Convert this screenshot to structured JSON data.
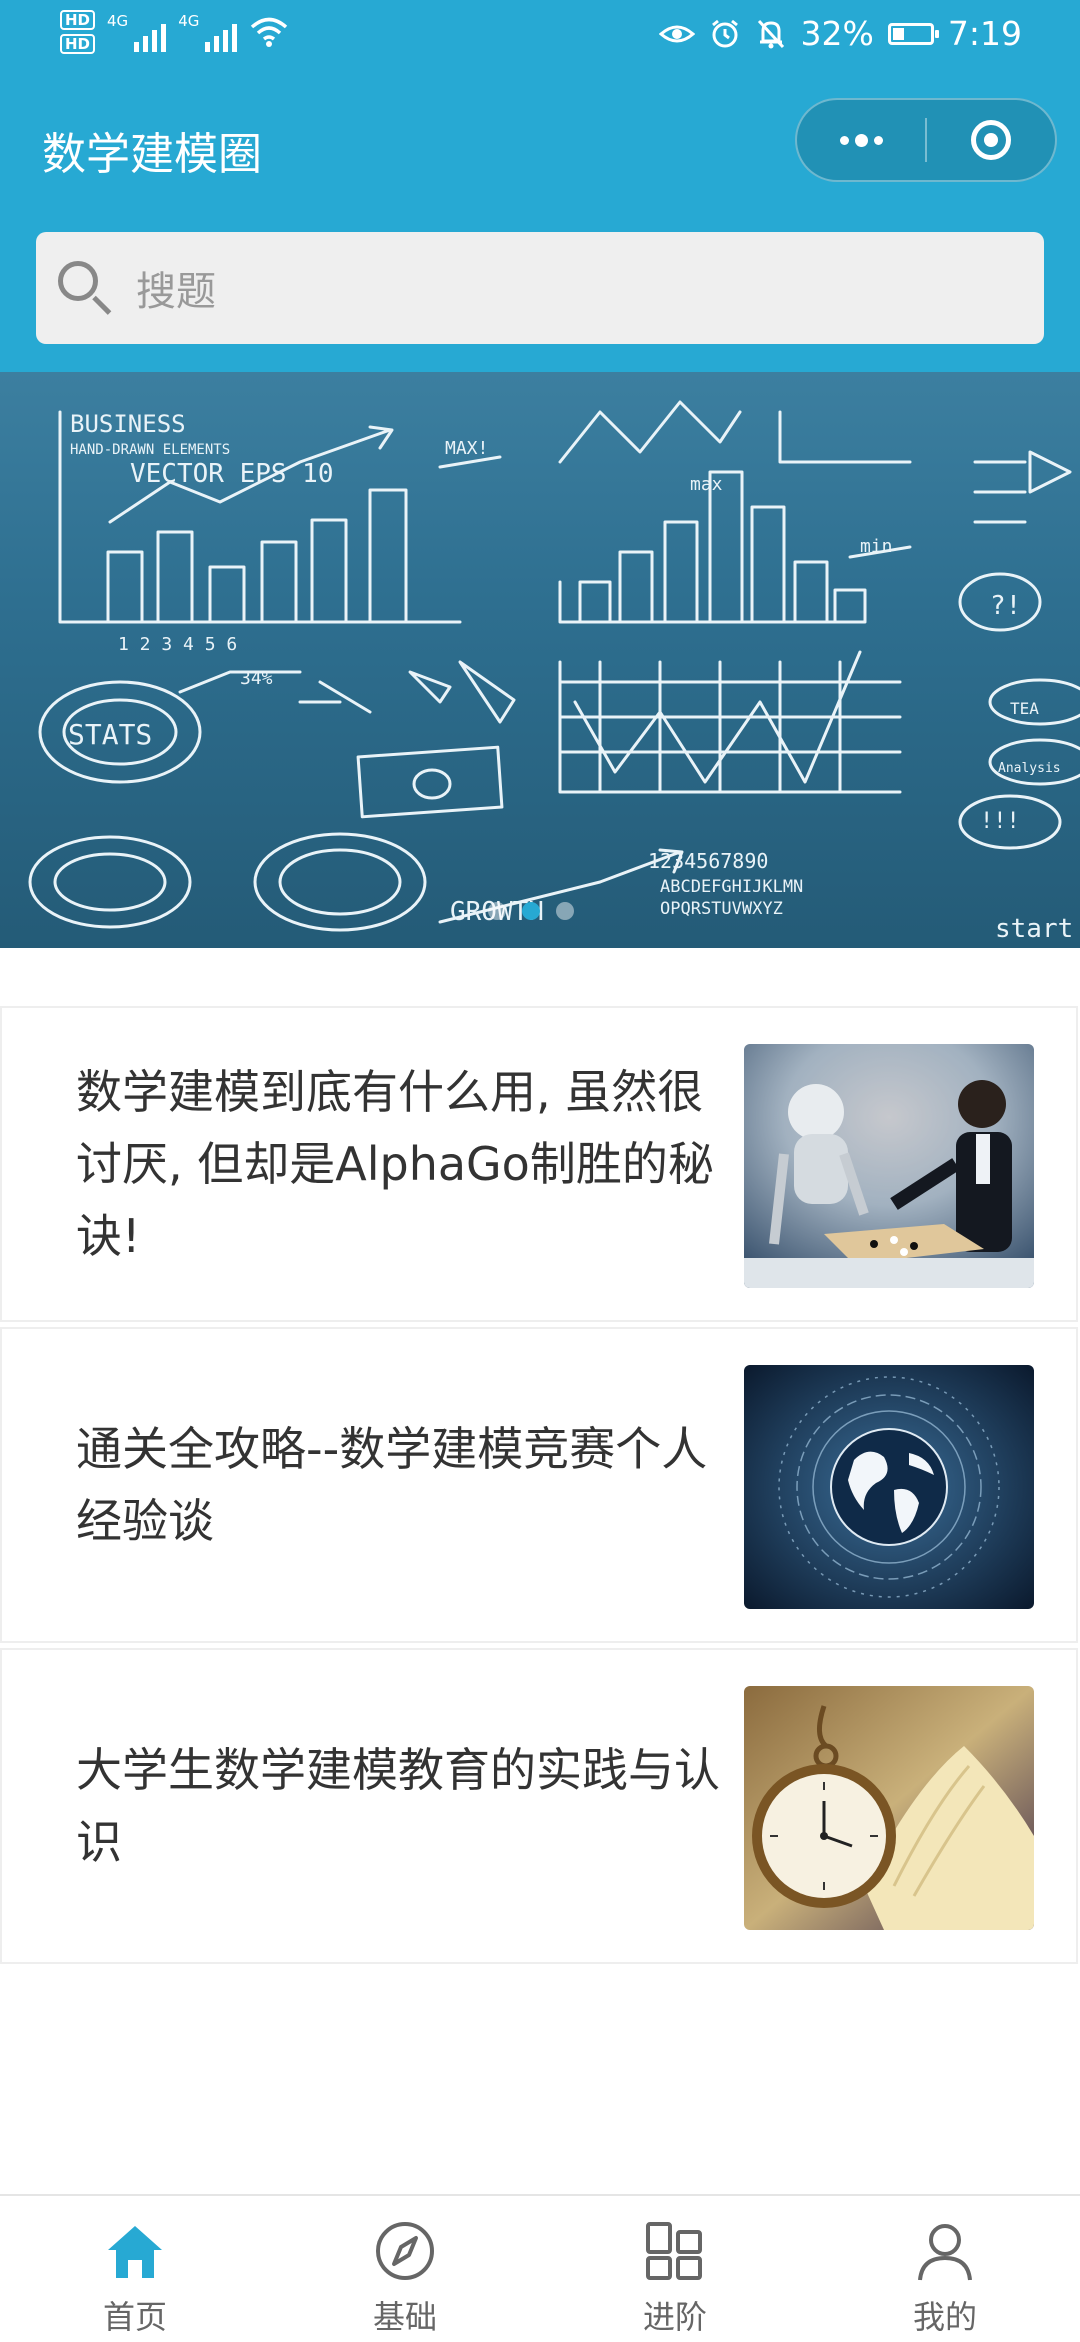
{
  "status_bar": {
    "hd_badges": [
      "HD",
      "HD"
    ],
    "network": [
      "4G",
      "4G"
    ],
    "battery_level": 32,
    "battery_percent": "32%",
    "time": "7:19"
  },
  "header": {
    "title": "数学建模圈",
    "search_placeholder": "搜题"
  },
  "banner": {
    "slide_count": 3,
    "active_slide": 1
  },
  "articles": [
    {
      "title": "数学建模到底有什么用, 虽然很讨厌, 但却是AlphaGo制胜的秘诀!",
      "image": "robot-vs-human-go-image"
    },
    {
      "title": "通关全攻略--数学建模竞赛个人经验谈",
      "image": "globe-data-image"
    },
    {
      "title": "大学生数学建模教育的实践与认识",
      "image": "pocket-watch-book-image"
    }
  ],
  "tabbar": {
    "active": 0,
    "tabs": [
      {
        "label": "首页",
        "icon": "home-icon"
      },
      {
        "label": "基础",
        "icon": "compass-icon"
      },
      {
        "label": "进阶",
        "icon": "grid-icon"
      },
      {
        "label": "我的",
        "icon": "user-icon"
      }
    ]
  },
  "colors": {
    "brand": "#27a9d3",
    "inactive": "#666666"
  }
}
